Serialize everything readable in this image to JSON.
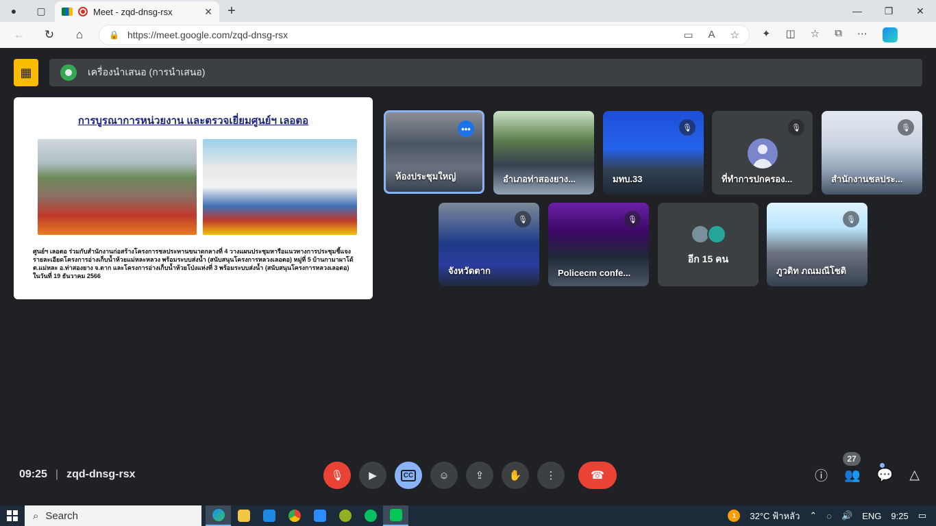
{
  "browser": {
    "tab_title": "Meet - zqd-dnsg-rsx",
    "tab_close": "✕",
    "new_tab": "+",
    "url": "https://meet.google.com/zqd-dnsg-rsx",
    "window_controls": [
      "—",
      "❐",
      "✕"
    ]
  },
  "meet": {
    "presenter_label": "เครื่องนำเสนอ (การนำเสนอ)",
    "slide": {
      "title": "การบูรณาการหน่วยงาน และตรวจเยี่ยมศูนย์ฯ เลอตอ",
      "body": "ศูนย์ฯ เลอตอ ร่วมกับสำนักงานก่อสร้างโครงการชลประทานขนาดกลางที่ 4 วางแผนประชุมหารือแนวทางการประชุมชี้แจงรายละเอียดโครงการอ่างเก็บน้ำห้วยแม่หละหลวง พร้อมระบบส่งน้ำ (สนับสนุนโครงการหลวงเลอตอ) หมู่ที่ 5 บ้านกามาผาโด้ ต.แม่หละ อ.ท่าสองยาง จ.ตาก และโครงการอ่างเก็บน้ำห้วยโป่งแห่งที่ 3 พร้อมระบบส่งน้ำ (สนับสนุนโครงการหลวงเลอตอ) ในวันที่ 19 ธันวาคม 2566"
    },
    "tiles": [
      {
        "name": "ห้องประชุมใหญ่"
      },
      {
        "name": "อำเภอท่าสองยาง..."
      },
      {
        "name": "มทบ.33"
      },
      {
        "name": "ที่ทำการปกครอง..."
      },
      {
        "name": "สำนักงานชลประ..."
      },
      {
        "name": "จังหวัดตาก"
      },
      {
        "name": "Policecm confe..."
      },
      {
        "name": "อีก 15 คน"
      },
      {
        "name": "ภูวดิท ภณมณีโชติ"
      }
    ],
    "time": "09:25",
    "separator": "|",
    "meeting_code": "zqd-dnsg-rsx",
    "participant_count": "27",
    "more_dots": "•••"
  },
  "taskbar": {
    "search_label": "Search",
    "weather": "32°C ฟ้าหลัว",
    "weather_badge": "1",
    "language": "ENG",
    "time": "9:25"
  }
}
